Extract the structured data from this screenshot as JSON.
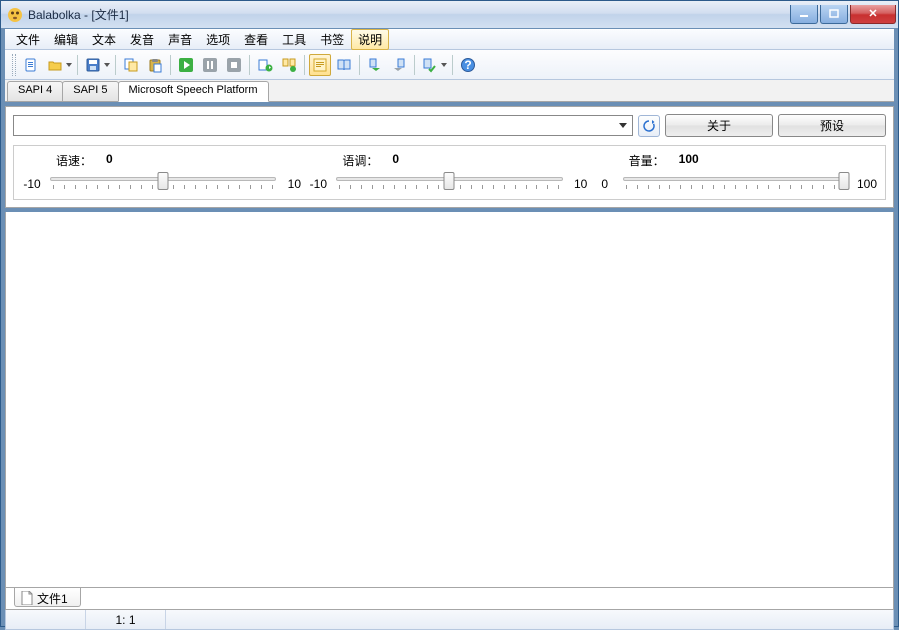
{
  "window": {
    "title": "Balabolka - [文件1]"
  },
  "menu": {
    "items": [
      "文件",
      "编辑",
      "文本",
      "发音",
      "声音",
      "选项",
      "查看",
      "工具",
      "书签",
      "说明"
    ],
    "selected_index": 9
  },
  "toolbar": {
    "icons": [
      "new-file-icon",
      "open-folder-icon",
      "save-icon",
      "copy-icon",
      "paste-icon",
      "play-icon",
      "pause-icon",
      "stop-icon",
      "export-audio-icon",
      "split-audio-icon",
      "highlight-text-icon",
      "book-icon",
      "nav-prev-icon",
      "nav-next-icon",
      "spellcheck-icon",
      "help-icon"
    ],
    "active_index": 10
  },
  "engine_tabs": {
    "items": [
      "SAPI 4",
      "SAPI 5",
      "Microsoft Speech Platform"
    ],
    "active_index": 2
  },
  "voice_panel": {
    "about_label": "关于",
    "preset_label": "预设",
    "sliders": {
      "speed": {
        "label": "语速：",
        "value": "0",
        "min": "-10",
        "max": "10",
        "pos": 50
      },
      "pitch": {
        "label": "语调：",
        "value": "0",
        "min": "-10",
        "max": "10",
        "pos": 50
      },
      "volume": {
        "label": "音量：",
        "value": "100",
        "min": "0",
        "max": "100",
        "pos": 100
      }
    }
  },
  "doc_tabs": {
    "items": [
      "文件1"
    ]
  },
  "status": {
    "line_col": "1:   1"
  }
}
